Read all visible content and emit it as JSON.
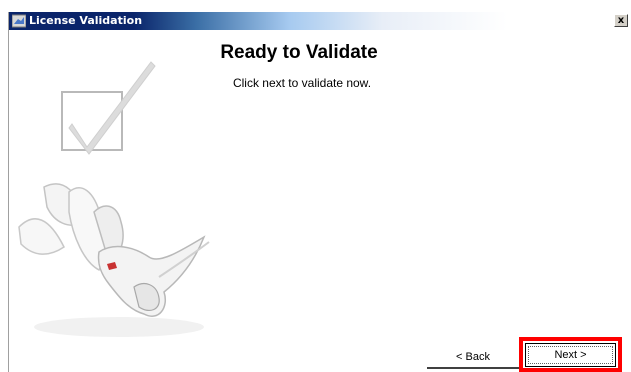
{
  "window": {
    "title": "License Validation",
    "close_label": "x"
  },
  "main": {
    "heading": "Ready to Validate",
    "instruction": "Click next to validate now."
  },
  "buttons": {
    "back_label": "< Back",
    "next_label": "Next >"
  },
  "colors": {
    "titlebar_active": "#0a246a",
    "highlight": "#ff0000"
  },
  "icons": {
    "title_icon": "app-icon",
    "checkmark": "checkmark-icon",
    "logo": "rhino-logo"
  }
}
